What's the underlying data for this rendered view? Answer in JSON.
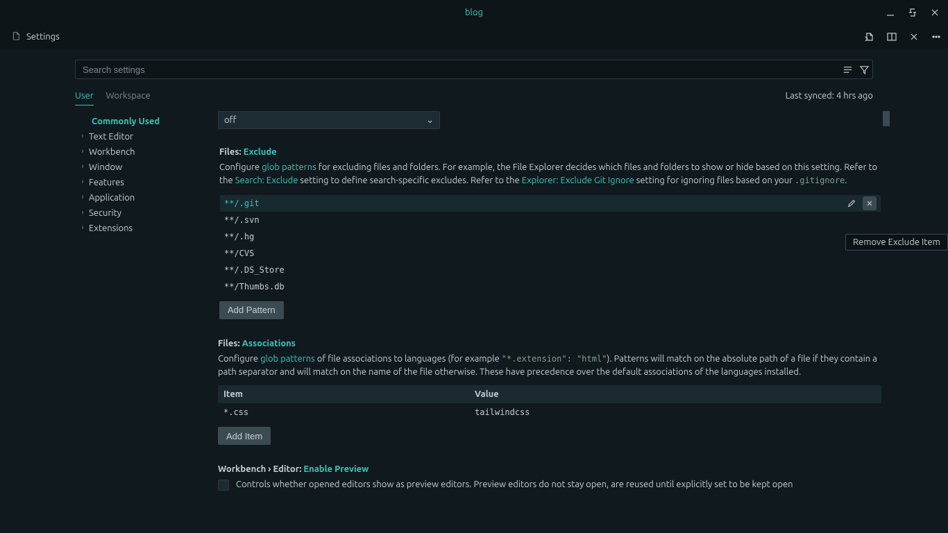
{
  "window": {
    "title": "blog"
  },
  "tab": {
    "label": "Settings"
  },
  "search": {
    "placeholder": "Search settings"
  },
  "scope": {
    "user": "User",
    "workspace": "Workspace"
  },
  "sync": {
    "text": "Last synced: 4 hrs ago"
  },
  "toc": {
    "commonly": "Commonly Used",
    "items": [
      "Text Editor",
      "Workbench",
      "Window",
      "Features",
      "Application",
      "Security",
      "Extensions"
    ]
  },
  "dropdown": {
    "value": "off"
  },
  "exclude": {
    "sec": "Files:",
    "key": "Exclude",
    "desc_pre": "Configure ",
    "link_glob": "glob patterns",
    "desc_1": " for excluding files and folders. For example, the File Explorer decides which files and folders to show or hide based on this setting. Refer to the ",
    "link_search": "Search: Exclude",
    "desc_2": " setting to define search-specific excludes. Refer to the ",
    "link_explorer": "Explorer: Exclude Git Ignore",
    "desc_3": " setting for ignoring files based on your ",
    "code_gitignore": ".gitignore",
    "desc_end": ".",
    "patterns": [
      "**/.git",
      "**/.svn",
      "**/.hg",
      "**/CVS",
      "**/.DS_Store",
      "**/Thumbs.db"
    ],
    "add_btn": "Add Pattern"
  },
  "assoc": {
    "sec": "Files:",
    "key": "Associations",
    "desc_pre": "Configure ",
    "link_glob": "glob patterns",
    "desc_1": " of file associations to languages (for example ",
    "code_example": "\"*.extension\": \"html\"",
    "desc_2": "). Patterns will match on the absolute path of a file if they contain a path separator and will match on the name of the file otherwise. These have precedence over the default associations of the languages installed.",
    "head_item": "Item",
    "head_value": "Value",
    "rows": [
      {
        "item": "*.css",
        "value": "tailwindcss"
      }
    ],
    "add_btn": "Add Item"
  },
  "preview": {
    "sec": "Workbench › Editor:",
    "key": "Enable Preview",
    "desc": "Controls whether opened editors show as preview editors. Preview editors do not stay open, are reused until explicitly set to be kept open"
  },
  "tooltip": {
    "text": "Remove Exclude Item"
  }
}
